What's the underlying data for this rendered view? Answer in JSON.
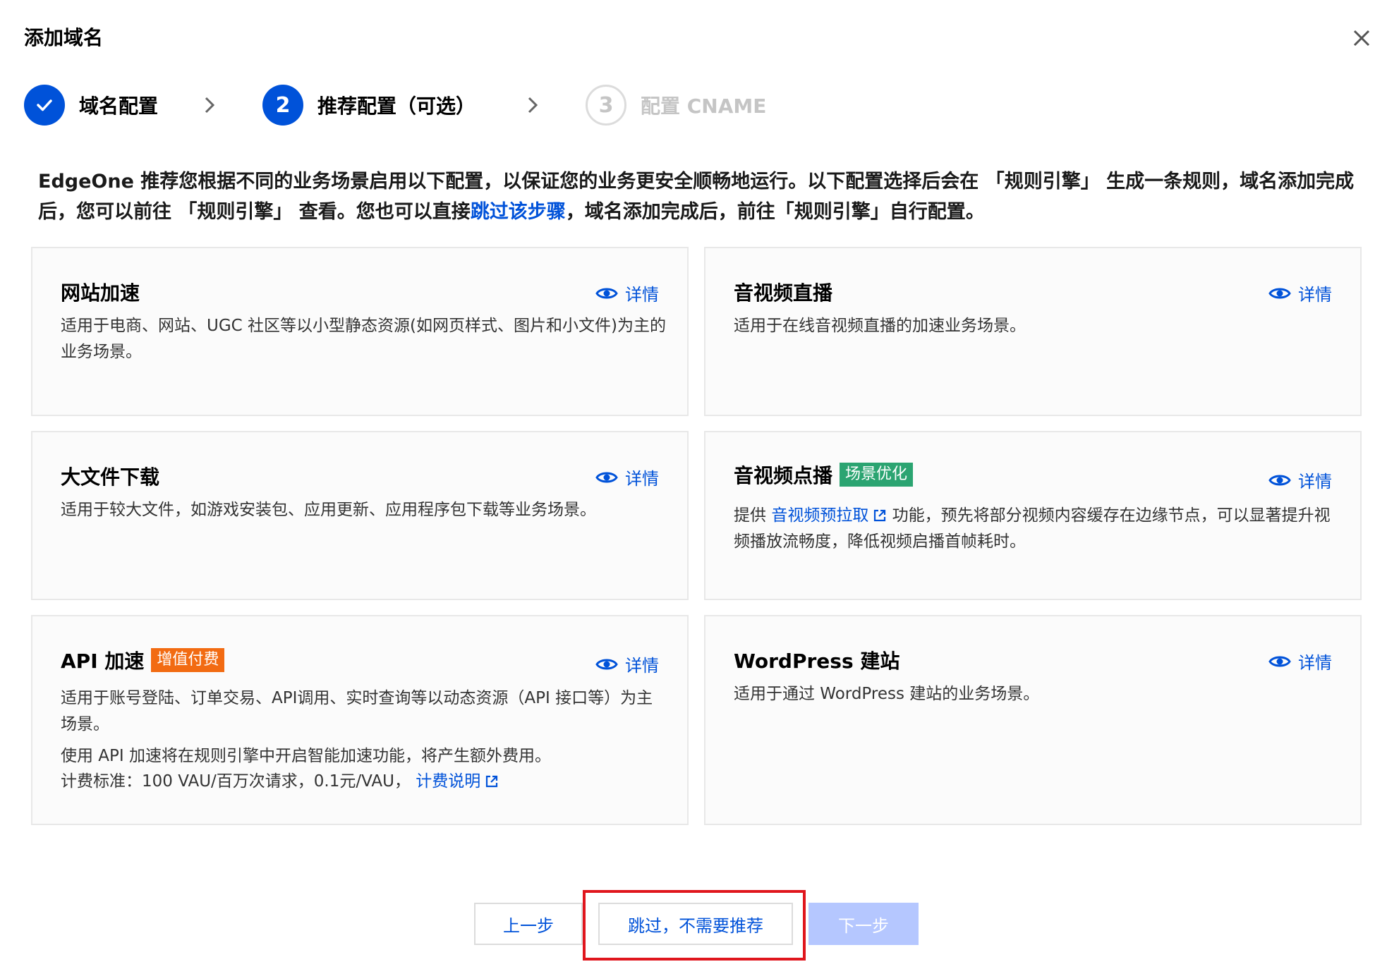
{
  "dialog": {
    "title": "添加域名",
    "close_icon": "close-icon"
  },
  "steps": [
    {
      "number": "",
      "label": "域名配置",
      "state": "done"
    },
    {
      "number": "2",
      "label": "推荐配置（可选）",
      "state": "active"
    },
    {
      "number": "3",
      "label": "配置 CNAME",
      "state": "pending"
    }
  ],
  "intro": {
    "text_before": "EdgeOne 推荐您根据不同的业务场景启用以下配置，以保证您的业务更安全顺畅地运行。以下配置选择后会在 「规则引擎」 生成一条规则，域名添加完成后，您可以前往 「规则引擎」 查看。您也可以直接",
    "link": "跳过该步骤",
    "text_after": "，域名添加完成后，前往「规则引擎」自行配置。"
  },
  "detail_label": "详情",
  "cards": {
    "site_accel": {
      "title": "网站加速",
      "desc": "适用于电商、网站、UGC 社区等以小型静态资源(如网页样式、图片和小文件)为主的业务场景。"
    },
    "live": {
      "title": "音视频直播",
      "desc": "适用于在线音视频直播的加速业务场景。"
    },
    "download": {
      "title": "大文件下载",
      "desc": "适用于较大文件，如游戏安装包、应用更新、应用程序包下载等业务场景。"
    },
    "vod": {
      "title": "音视频点播",
      "tag": "场景优化",
      "desc_prefix": "提供 ",
      "desc_link": "音视频预拉取",
      "desc_suffix": " 功能，预先将部分视频内容缓存在边缘节点，可以显著提升视频播放流畅度，降低视频启播首帧耗时。"
    },
    "api": {
      "title": "API 加速",
      "tag": "增值付费",
      "desc": "适用于账号登陆、订单交易、API调用、实时查询等以动态资源（API 接口等）为主场景。",
      "note": "使用 API 加速将在规则引擎中开启智能加速功能，将产生额外费用。",
      "pricing": "计费标准：100 VAU/百万次请求，0.1元/VAU，",
      "pricing_link": "计费说明"
    },
    "wordpress": {
      "title": "WordPress 建站",
      "desc": "适用于通过 WordPress 建站的业务场景。"
    }
  },
  "footer": {
    "prev_label": "上一步",
    "skip_label": "跳过，不需要推荐",
    "next_label": "下一步"
  },
  "colors": {
    "primary": "#0052d9",
    "tag_green": "#2ba471",
    "tag_orange": "#f26b12",
    "highlight": "#e0161d",
    "disabled": "#b5c7ff"
  }
}
